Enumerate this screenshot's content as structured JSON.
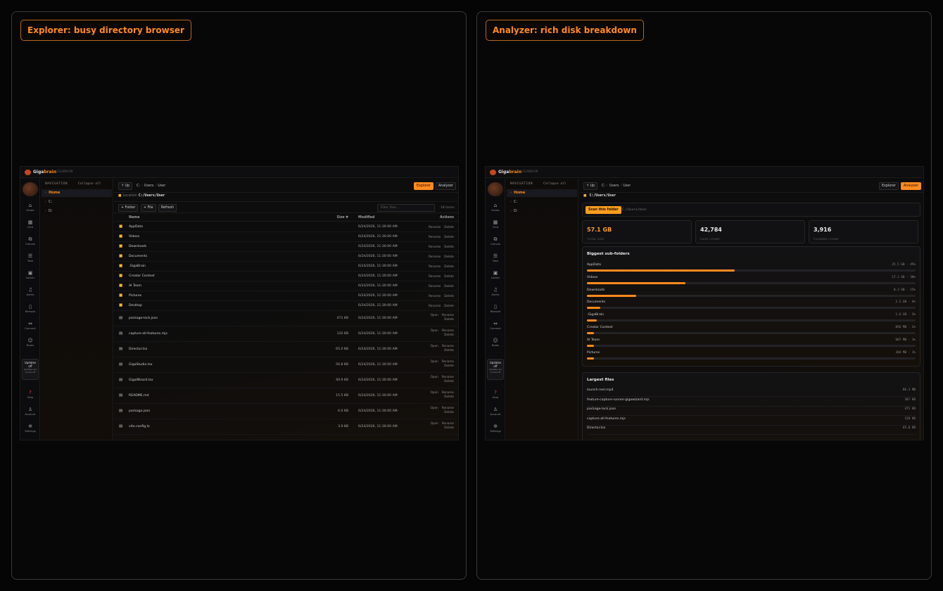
{
  "panels": {
    "left_label": "Explorer: busy directory browser",
    "right_label": "Analyzer: rich disk breakdown"
  },
  "app": {
    "brand_a": "Giga",
    "brand_b": "brain",
    "version": "GIGABRAIN"
  },
  "rail": {
    "items": [
      {
        "label": "Home",
        "icon": "home-icon"
      },
      {
        "label": "Grid",
        "icon": "grid-icon"
      },
      {
        "label": "Canvas",
        "icon": "canvas-icon"
      },
      {
        "label": "Task",
        "icon": "task-icon"
      },
      {
        "label": "Locker",
        "icon": "locker-icon"
      },
      {
        "label": "Alerts",
        "icon": "bell-icon"
      },
      {
        "label": "Remote",
        "icon": "phone-icon"
      },
      {
        "label": "Connect",
        "icon": "connect-icon"
      },
      {
        "label": "Roles",
        "icon": "users-icon"
      }
    ],
    "updates_title": "Updates off",
    "updates_sub": "Updates are turned off",
    "bottom": [
      {
        "label": "Help",
        "icon": "help-icon"
      },
      {
        "label": "Account",
        "icon": "account-icon"
      },
      {
        "label": "Settings",
        "icon": "gear-icon"
      }
    ]
  },
  "nav": {
    "heading": "NAVIGATION",
    "collapse": "Collapse all",
    "items": [
      "Home",
      "C:",
      "D:"
    ]
  },
  "toolbar": {
    "up": "↑ Up",
    "crumbs": [
      "C:",
      "Users",
      "User"
    ],
    "explorer": "Explorer",
    "analyzer": "Analyzer"
  },
  "location": {
    "label": "Location",
    "path": "C:/Users/User"
  },
  "explorer": {
    "new_folder": "+ Folder",
    "new_file": "+ File",
    "refresh": "Refresh",
    "filter_placeholder": "Filter files...",
    "count": "18 items",
    "columns": {
      "name": "Name",
      "size": "Size ▼",
      "modified": "Modified",
      "actions": "Actions"
    },
    "folders": [
      {
        "name": "AppData",
        "modified": "6/24/2026, 11:30:00 AM"
      },
      {
        "name": "Videos",
        "modified": "6/24/2026, 11:30:00 AM"
      },
      {
        "name": "Downloads",
        "modified": "6/24/2026, 11:30:00 AM"
      },
      {
        "name": "Documents",
        "modified": "6/24/2026, 11:30:00 AM"
      },
      {
        "name": ".GigaBrain",
        "modified": "6/24/2026, 11:30:00 AM"
      },
      {
        "name": "Creator Context",
        "modified": "6/24/2026, 11:30:00 AM"
      },
      {
        "name": "AI Team",
        "modified": "6/24/2026, 11:30:00 AM"
      },
      {
        "name": "Pictures",
        "modified": "6/24/2026, 11:30:00 AM"
      },
      {
        "name": "Desktop",
        "modified": "6/24/2026, 11:30:00 AM"
      }
    ],
    "files": [
      {
        "name": "package-lock.json",
        "size": "471 KB",
        "modified": "6/24/2026, 11:30:00 AM"
      },
      {
        "name": "capture-all-features.mjs",
        "size": "120 KB",
        "modified": "6/24/2026, 11:30:00 AM"
      },
      {
        "name": "Director.tsx",
        "size": "65.0 KB",
        "modified": "6/24/2026, 11:30:00 AM"
      },
      {
        "name": "GigaStudio.tsx",
        "size": "56.8 KB",
        "modified": "6/24/2026, 11:30:00 AM"
      },
      {
        "name": "GigaWizard.tsx",
        "size": "40.9 KB",
        "modified": "6/24/2026, 11:30:00 AM"
      },
      {
        "name": "README.md",
        "size": "15.5 KB",
        "modified": "6/24/2026, 11:30:00 AM"
      },
      {
        "name": "package.json",
        "size": "6.0 KB",
        "modified": "6/24/2026, 11:30:00 AM"
      },
      {
        "name": "vite.config.ts",
        "size": "3.9 KB",
        "modified": "6/24/2026, 11:30:00 AM"
      }
    ],
    "action_open": "Open",
    "action_rename": "Rename",
    "action_delete": "Delete"
  },
  "analyzer": {
    "scan_button": "Scan this folder",
    "scan_path": "C:/Users/User",
    "stats": [
      {
        "value": "57.1 GB",
        "label": "TOTAL SIZE"
      },
      {
        "value": "42,784",
        "label": "FILES COUNT"
      },
      {
        "value": "3,916",
        "label": "FOLDERS COUNT"
      }
    ],
    "biggest_title": "Biggest sub-folders",
    "biggest": [
      {
        "name": "AppData",
        "value": "25.5 GB · 45%",
        "pct": 45
      },
      {
        "name": "Videos",
        "value": "17.1 GB · 30%",
        "pct": 30
      },
      {
        "name": "Downloads",
        "value": "8.3 GB · 15%",
        "pct": 15
      },
      {
        "name": "Documents",
        "value": "2.2 GB · 4%",
        "pct": 4
      },
      {
        "name": ".GigaBrain",
        "value": "1.6 GB · 3%",
        "pct": 3
      },
      {
        "name": "Creator Context",
        "value": "856 MB · 2%",
        "pct": 2
      },
      {
        "name": "AI Team",
        "value": "607 MB · 1%",
        "pct": 1
      },
      {
        "name": "Pictures",
        "value": "384 MB · 1%",
        "pct": 1
      }
    ],
    "largest_title": "Largest files",
    "largest": [
      {
        "name": "launch-reel.mp4",
        "value": "86.3 MB"
      },
      {
        "name": "feature-capture-runner-gigawizard.mjs",
        "value": "307 KB"
      },
      {
        "name": "package-lock.json",
        "value": "471 KB"
      },
      {
        "name": "capture-all-features.mjs",
        "value": "120 KB"
      },
      {
        "name": "Director.tsx",
        "value": "65.0 KB"
      }
    ]
  }
}
